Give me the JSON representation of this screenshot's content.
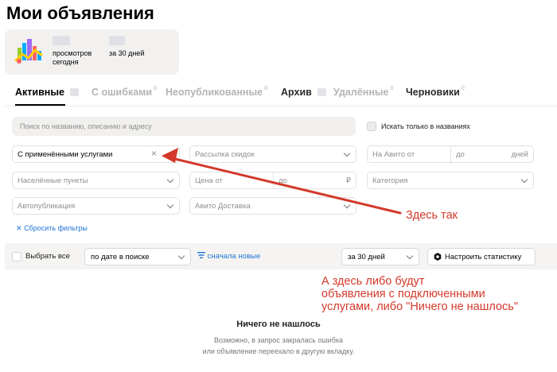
{
  "page": {
    "title": "Мои объявления"
  },
  "stats": {
    "views_label_line1": "просмотров",
    "views_label_line2": "сегодня",
    "period_label": "за 30 дней",
    "logo_icon": "stats-chart-logo-icon"
  },
  "tabs": [
    {
      "label": "Активные",
      "count": "",
      "state": "active"
    },
    {
      "label": "С ошибками",
      "count": "0",
      "state": "muted"
    },
    {
      "label": "Неопубликованные",
      "count": "0",
      "state": "muted"
    },
    {
      "label": "Архив",
      "count": "",
      "state": "normal"
    },
    {
      "label": "Удалённые",
      "count": "0",
      "state": "muted"
    },
    {
      "label": "Черновики",
      "count": "0",
      "state": "normal"
    }
  ],
  "search": {
    "placeholder": "Поиск по названию, описанию и адресу",
    "names_only_label": "Искать только в названиях"
  },
  "filters": {
    "services": "С применёнными услугами",
    "services_clear_icon": "close-icon",
    "discount_mailing": "Рассылка скидок",
    "avito_from": "На Авито от",
    "avito_to": "до",
    "avito_unit": "дней",
    "localities": "Населённые пункты",
    "price_from": "Цена от",
    "price_to": "до",
    "price_currency": "₽",
    "category": "Категория",
    "autopublish": "Автопубликация",
    "delivery": "Авито Доставка",
    "reset_label": "Сбросить фильтры"
  },
  "toolbar": {
    "select_all": "Выбрать все",
    "sort_by": "по дате в поиске",
    "sort_order": "сначала новые",
    "period": "за 30 дней",
    "configure_stats": "Настроить статистику"
  },
  "empty_state": {
    "title": "Ничего не нашлось",
    "line1": "Возможно, в запрос закралась ошибка",
    "line2": "или объявление переехало в другую вкладку."
  },
  "annotations": {
    "arrow_label": "Здесь так",
    "note_line1": "А здесь либо будут",
    "note_line2": "объявления с подключенными",
    "note_line3": "услугами, либо \"Ничего не нашлось\"",
    "color": "#d4392b"
  },
  "colors": {
    "accent_link": "#1f75d6",
    "annotation": "#d4392b"
  }
}
